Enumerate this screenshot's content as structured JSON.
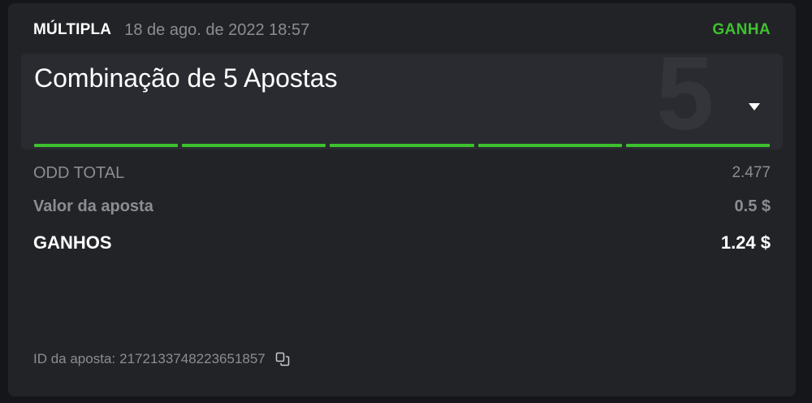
{
  "header": {
    "bet_type": "MÚLTIPLA",
    "date": "18 de ago. de 2022 18:57",
    "status": "GANHA"
  },
  "combo": {
    "title": "Combinação de 5 Apostas",
    "count": "5",
    "dropdown_icon": "caret-down-icon",
    "legs": [
      {
        "result": "won"
      },
      {
        "result": "won"
      },
      {
        "result": "won"
      },
      {
        "result": "won"
      },
      {
        "result": "won"
      }
    ]
  },
  "details": {
    "odd_total_label": "ODD TOTAL",
    "odd_total_value": "2.477",
    "stake_label": "Valor da aposta",
    "stake_value": "0.5 $",
    "winnings_label": "GANHOS",
    "winnings_value": "1.24 $"
  },
  "footer": {
    "bet_id_label": "ID da aposta:",
    "bet_id_value": "2172133748223651857",
    "copy_icon": "copy-icon"
  },
  "colors": {
    "accent_green": "#3ec12e",
    "card_bg": "#222327",
    "page_bg": "#151619",
    "muted_text": "#8b8d93"
  }
}
